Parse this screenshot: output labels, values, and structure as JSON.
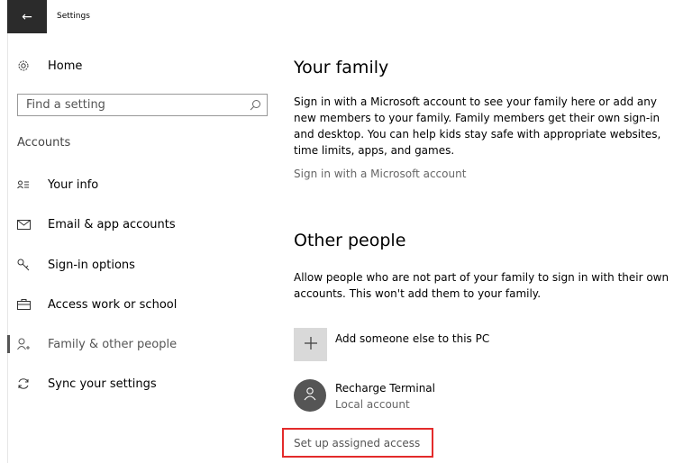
{
  "window": {
    "title": "Settings",
    "back_glyph": "←"
  },
  "sidebar": {
    "home": {
      "label": "Home",
      "icon": "gear-icon"
    },
    "search": {
      "placeholder": "Find a setting",
      "icon": "search-icon"
    },
    "section_heading": "Accounts",
    "items": [
      {
        "label": "Your info",
        "icon": "person-card-icon",
        "selected": false
      },
      {
        "label": "Email & app accounts",
        "icon": "envelope-icon",
        "selected": false
      },
      {
        "label": "Sign-in options",
        "icon": "key-icon",
        "selected": false
      },
      {
        "label": "Access work or school",
        "icon": "briefcase-icon",
        "selected": false
      },
      {
        "label": "Family & other people",
        "icon": "person-add-icon",
        "selected": true
      },
      {
        "label": "Sync your settings",
        "icon": "sync-icon",
        "selected": false
      }
    ]
  },
  "main": {
    "family": {
      "heading": "Your family",
      "description": "Sign in with a Microsoft account to see your family here or add any new members to your family. Family members get their own sign-in and desktop. You can help kids stay safe with appropriate websites, time limits, apps, and games.",
      "link": "Sign in with a Microsoft account"
    },
    "other_people": {
      "heading": "Other people",
      "description": "Allow people who are not part of your family to sign in with their own accounts. This won't add them to your family.",
      "add_label": "Add someone else to this PC",
      "users": [
        {
          "name": "Recharge Terminal",
          "type": "Local account"
        }
      ],
      "assigned_access_link": "Set up assigned access"
    }
  },
  "colors": {
    "highlight_border": "#e32b2b",
    "back_button_bg": "#2b2b2b",
    "avatar_bg": "#555555"
  }
}
